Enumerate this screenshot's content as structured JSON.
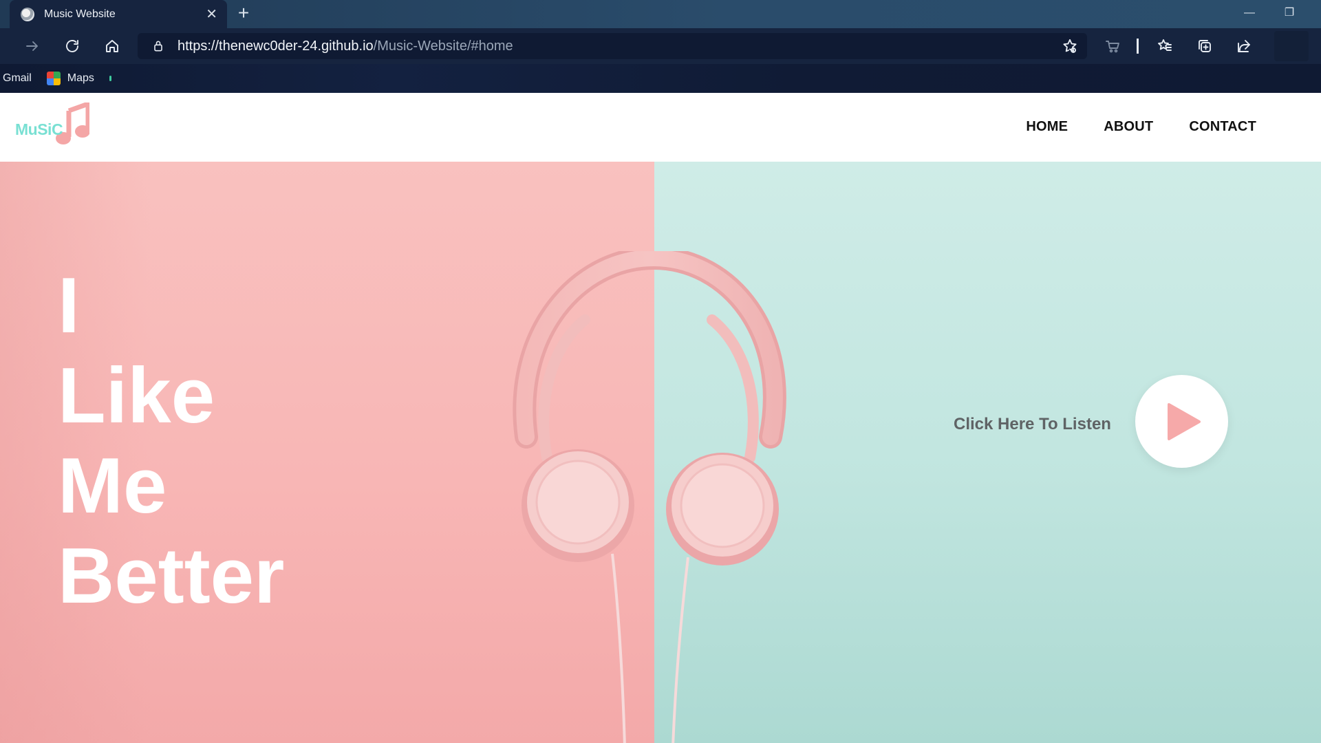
{
  "browser": {
    "tab_title": "Music Website",
    "url_main": "https://thenewc0der-24.github.io",
    "url_rest": "/Music-Website/#home",
    "bookmarks": [
      {
        "label": "Gmail"
      },
      {
        "label": "Maps"
      }
    ]
  },
  "site": {
    "logo_text": "MuSiC",
    "nav": [
      "HOME",
      "ABOUT",
      "CONTACT"
    ],
    "headline": [
      "I",
      "Like",
      "Me",
      "Better"
    ],
    "listen_text": "Click Here To Listen"
  },
  "colors": {
    "hero_left": "#f8b8b7",
    "hero_right": "#c2e6e0",
    "logo_text": "#79e0d3",
    "logo_note": "#f4a6a6",
    "play_icon": "#f6a9a9",
    "browser_toolbar": "#16243f"
  }
}
